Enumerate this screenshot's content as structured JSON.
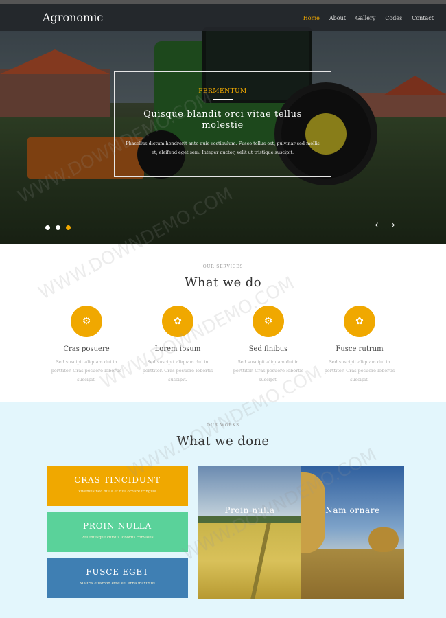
{
  "nav": {
    "logo": "Agronomic",
    "items": [
      {
        "label": "Home",
        "active": true
      },
      {
        "label": "About",
        "active": false
      },
      {
        "label": "Gallery",
        "active": false
      },
      {
        "label": "Codes",
        "active": false
      },
      {
        "label": "Contact",
        "active": false
      }
    ]
  },
  "hero": {
    "kicker": "FERMENTUM",
    "title": "Quisque blandit orci vitae tellus molestie",
    "text": "Phasellus dictum hendrerit ante quis vestibulum. Fusce tellus est, pulvinar sed mollis et, eleifend eget sem. Integer auctor, velit ut tristique suscipit.",
    "slides_total": 3,
    "active_slide": 3,
    "prev_glyph": "‹",
    "next_glyph": "›"
  },
  "services": {
    "kicker": "OUR SERVICES",
    "title": "What we do",
    "items": [
      {
        "icon": "gear-icon",
        "glyph": "⚙",
        "title": "Cras posuere",
        "text": "Sed suscipit aliquam dui in porttitor. Cras posuere lobortis suscipit."
      },
      {
        "icon": "leaf-icon",
        "glyph": "✿",
        "title": "Lorem ipsum",
        "text": "Sed suscipit aliquam dui in porttitor. Cras posuere lobortis suscipit."
      },
      {
        "icon": "gear-icon",
        "glyph": "⚙",
        "title": "Sed finibus",
        "text": "Sed suscipit aliquam dui in porttitor. Cras posuere lobortis suscipit."
      },
      {
        "icon": "leaf-icon",
        "glyph": "✿",
        "title": "Fusce rutrum",
        "text": "Sed suscipit aliquam dui in porttitor. Cras posuere lobortis suscipit."
      }
    ]
  },
  "works": {
    "kicker": "OUR WORKS",
    "title": "What we done",
    "cards": [
      {
        "title": "CRAS TINCIDUNT",
        "subtitle": "Vivamus nec nulla et nisl ornare fringilla",
        "color": "#f0a800"
      },
      {
        "title": "PROIN NULLA",
        "subtitle": "Pellentesque cursus lobortis convallis",
        "color": "#5ad29a"
      },
      {
        "title": "FUSCE EGET",
        "subtitle": "Mauris euismod eros vel urna maximus",
        "color": "#3f7fb3"
      }
    ],
    "photos": [
      {
        "caption": "Proin nulla"
      },
      {
        "caption": "Nam ornare"
      }
    ]
  },
  "watermark": "WWW.DOWNDEMO.COM",
  "colors": {
    "accent": "#f0a800",
    "works_bg": "#e3f6fc",
    "topbar": "#23262a"
  }
}
